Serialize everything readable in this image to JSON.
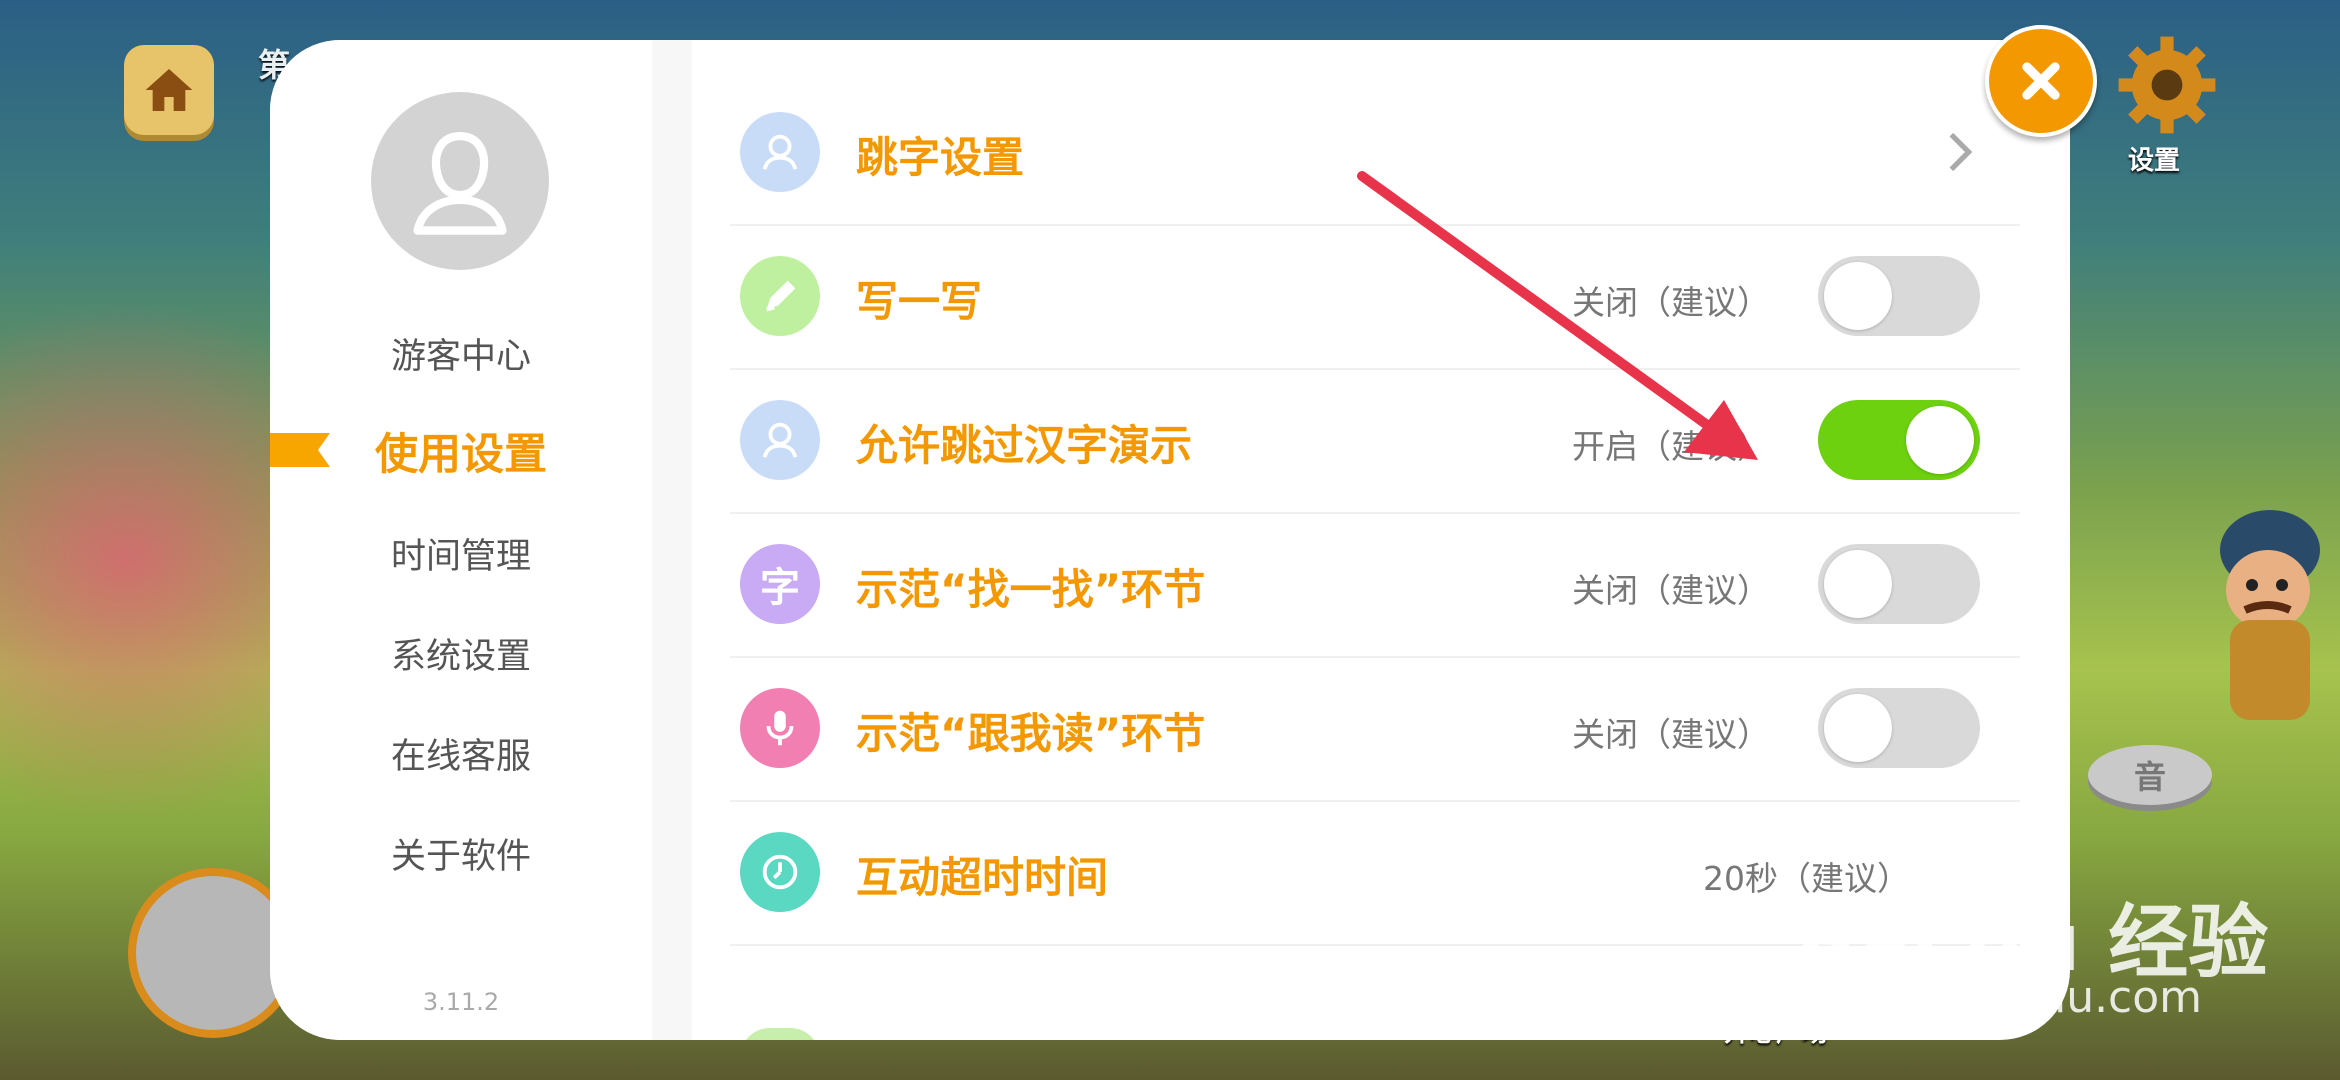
{
  "background": {
    "top_left_text": "第",
    "settings_label": "设置",
    "sound_label": "音",
    "bottom_labels": [
      "",
      "",
      "",
      "",
      "开心广场"
    ]
  },
  "sidebar": {
    "items": [
      {
        "label": "游客中心",
        "active": false
      },
      {
        "label": "使用设置",
        "active": true
      },
      {
        "label": "时间管理",
        "active": false
      },
      {
        "label": "系统设置",
        "active": false
      },
      {
        "label": "在线客服",
        "active": false
      },
      {
        "label": "关于软件",
        "active": false
      }
    ],
    "version": "3.11.2"
  },
  "settings": {
    "rows": [
      {
        "title": "跳字设置",
        "icon": "user-icon",
        "icon_color": "#a9c6f0",
        "control": "chevron"
      },
      {
        "title": "写一写",
        "icon": "pen-icon",
        "icon_color": "#b4ec88",
        "status": "关闭（建议）",
        "control": "toggle",
        "on": false
      },
      {
        "title": "允许跳过汉字演示",
        "icon": "user-icon",
        "icon_color": "#a9c6f0",
        "status": "开启（建议）",
        "control": "toggle",
        "on": true
      },
      {
        "title": "示范“找一找”环节",
        "icon": "zi-icon",
        "icon_color": "#c4a6f3",
        "status": "关闭（建议）",
        "control": "toggle",
        "on": false
      },
      {
        "title": "示范“跟我读”环节",
        "icon": "microphone-icon",
        "icon_color": "#f07eb0",
        "status": "关闭（建议）",
        "control": "toggle",
        "on": false
      },
      {
        "title": "互动超时时间",
        "icon": "clock-icon",
        "icon_color": "#55d6bf",
        "status": "20秒（建议）",
        "control": "none"
      }
    ],
    "zi_glyph": "字"
  },
  "watermark": {
    "brand": "Bai du 经验",
    "url": "jingyan.baidu.com"
  },
  "colors": {
    "accent": "#f39800",
    "toggle_on": "#6dd10f",
    "toggle_off": "#d9d9d9",
    "arrow": "#e8344a"
  }
}
